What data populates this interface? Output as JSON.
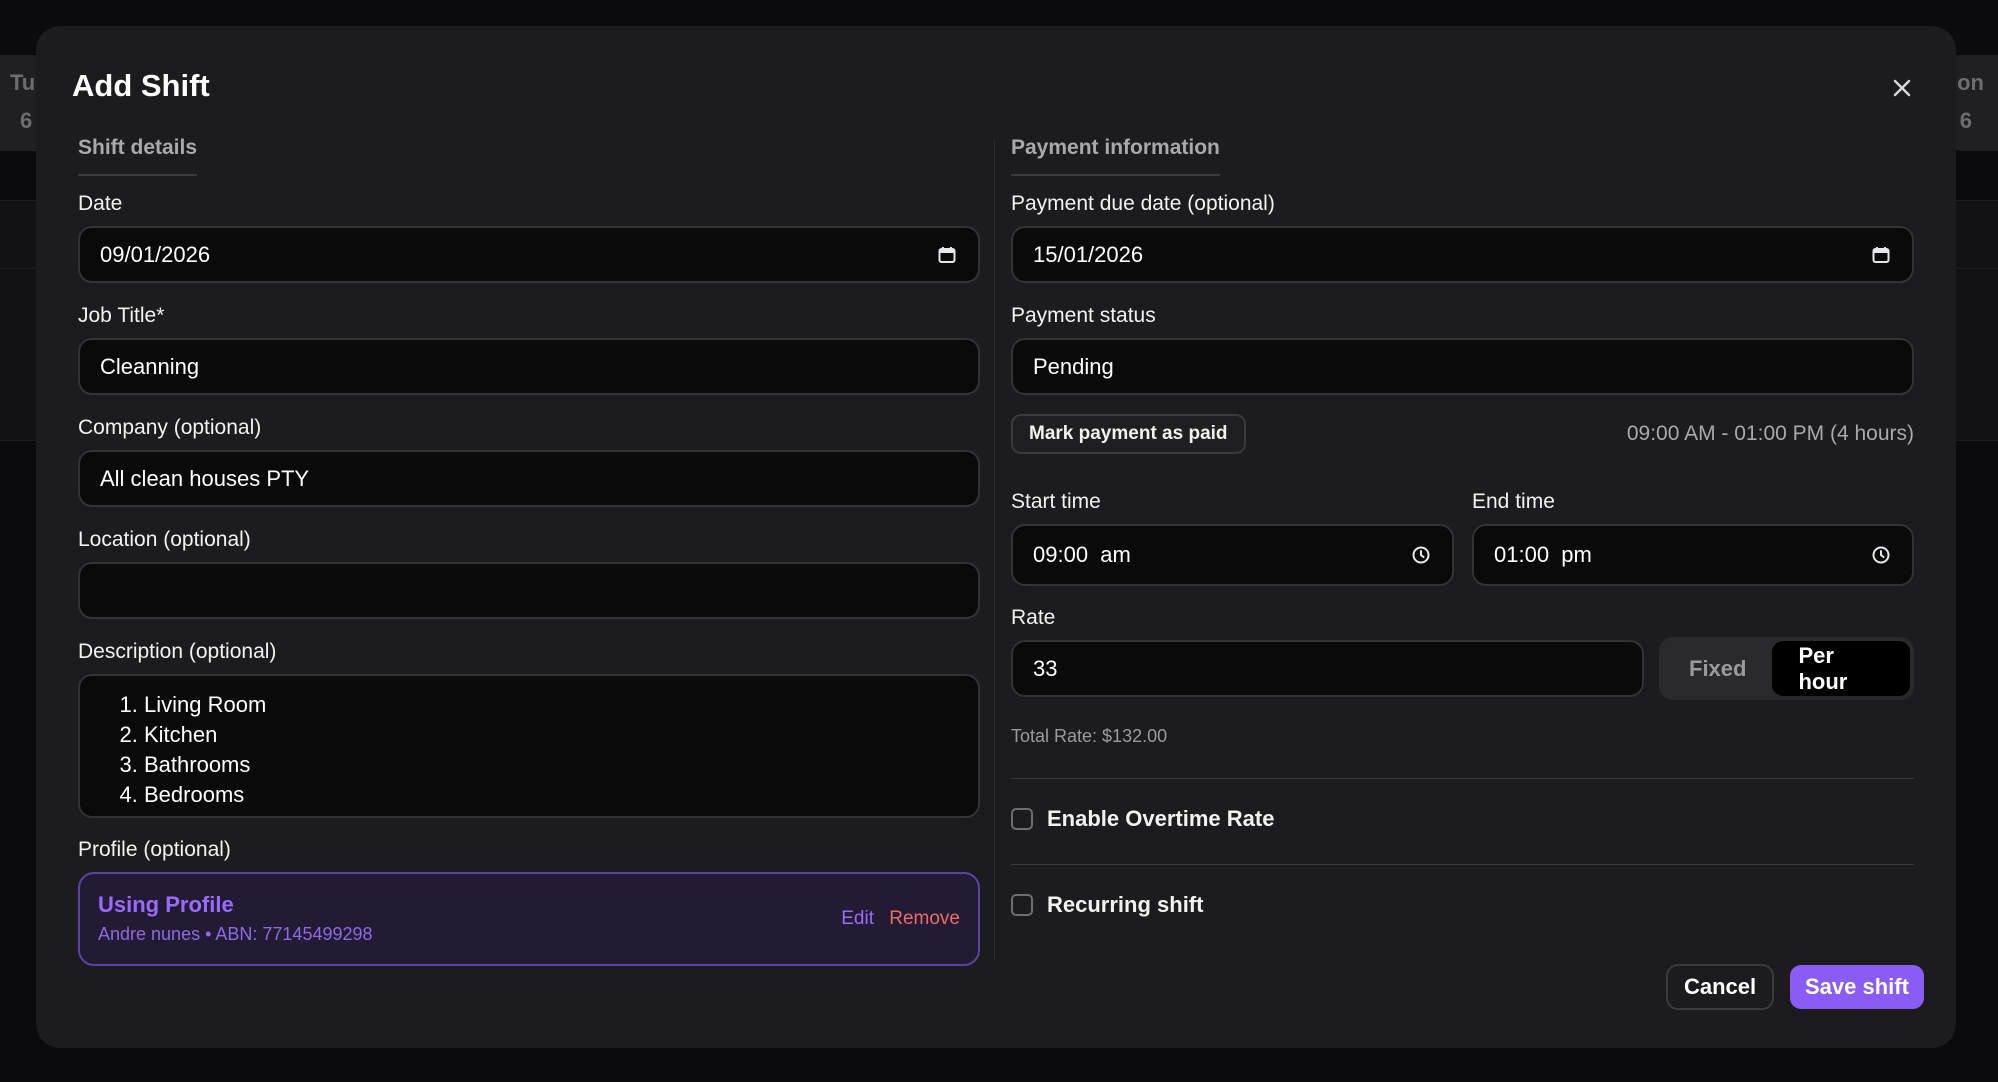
{
  "background": {
    "left_day": "Tu",
    "left_num": "6",
    "right_day": "on",
    "right_num": "6"
  },
  "modal": {
    "title": "Add Shift"
  },
  "shift_details": {
    "section_title": "Shift details",
    "date_label": "Date",
    "date_value": "09/01/2026",
    "job_title_label": "Job Title*",
    "job_title_value": "Cleanning",
    "company_label": "Company (optional)",
    "company_value": "All clean houses PTY",
    "location_label": "Location (optional)",
    "location_value": "",
    "description_label": "Description (optional)",
    "description_items": [
      "Living Room",
      "Kitchen",
      "Bathrooms",
      "Bedrooms"
    ],
    "profile_label": "Profile (optional)",
    "profile": {
      "title": "Using Profile",
      "subtitle": "Andre nunes • ABN: 77145499298",
      "edit": "Edit",
      "remove": "Remove"
    }
  },
  "payment_info": {
    "section_title": "Payment information",
    "due_date_label": "Payment due date (optional)",
    "due_date_value": "15/01/2026",
    "status_label": "Payment status",
    "status_value": "Pending",
    "mark_paid_label": "Mark payment as paid",
    "time_summary": "09:00 AM - 01:00 PM (4 hours)",
    "start_time_label": "Start time",
    "start_time_value": "09:00  am",
    "end_time_label": "End time",
    "end_time_value": "01:00  pm",
    "rate_label": "Rate",
    "rate_value": "33",
    "rate_type_fixed": "Fixed",
    "rate_type_per_hour": "Per hour",
    "total_rate": "Total Rate: $132.00",
    "overtime_label": "Enable Overtime Rate",
    "recurring_label": "Recurring shift"
  },
  "footer": {
    "cancel": "Cancel",
    "save": "Save shift"
  },
  "colors": {
    "accent": "#8a5cf6",
    "danger": "#f06a6a"
  }
}
